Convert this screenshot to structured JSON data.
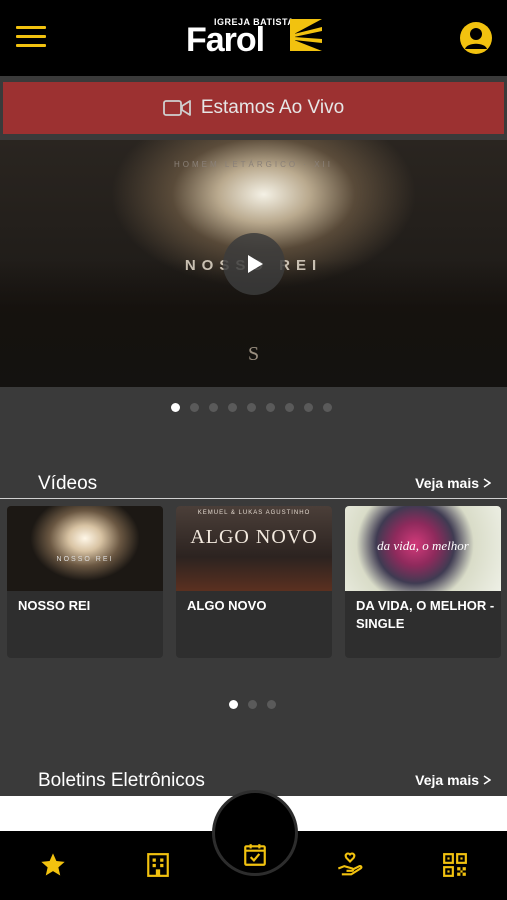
{
  "header": {
    "logo_sub": "IGREJA BATISTA",
    "logo_main": "Farol",
    "menu_icon": "menu-icon",
    "profile_icon": "user-icon",
    "accent_color": "#f2c20f"
  },
  "live_banner": {
    "label": "Estamos Ao Vivo",
    "icon": "video-camera-icon",
    "color": "#9c3131"
  },
  "hero": {
    "subtitle": "HOMEM LETÁRGICO · XII",
    "title": "NOSSO REI",
    "monogram": "S",
    "play_icon": "play-icon",
    "carousel_count": 9,
    "carousel_active": 1
  },
  "videos": {
    "title": "Vídeos",
    "see_more": "Veja mais",
    "items": [
      {
        "caption": "NOSSO REI",
        "thumb_title": "NOSSO REI"
      },
      {
        "caption": "ALGO NOVO",
        "thumb_title": "ALGO NOVO",
        "thumb_sub": "KEMUEL & LUKAS AGUSTINHO"
      },
      {
        "caption": "DA VIDA, O MELHOR - SINGLE",
        "thumb_title": "da vida, o melhor"
      }
    ],
    "carousel_count": 3,
    "carousel_active": 1
  },
  "bulletins": {
    "title": "Boletins Eletrônicos",
    "see_more": "Veja mais"
  },
  "bottom_nav": {
    "items": [
      {
        "name": "favorites",
        "icon": "star-icon"
      },
      {
        "name": "church",
        "icon": "building-icon"
      },
      {
        "name": "agenda",
        "icon": "calendar-check-icon"
      },
      {
        "name": "donate",
        "icon": "giving-hand-icon"
      },
      {
        "name": "qr",
        "icon": "qr-code-icon"
      }
    ]
  }
}
